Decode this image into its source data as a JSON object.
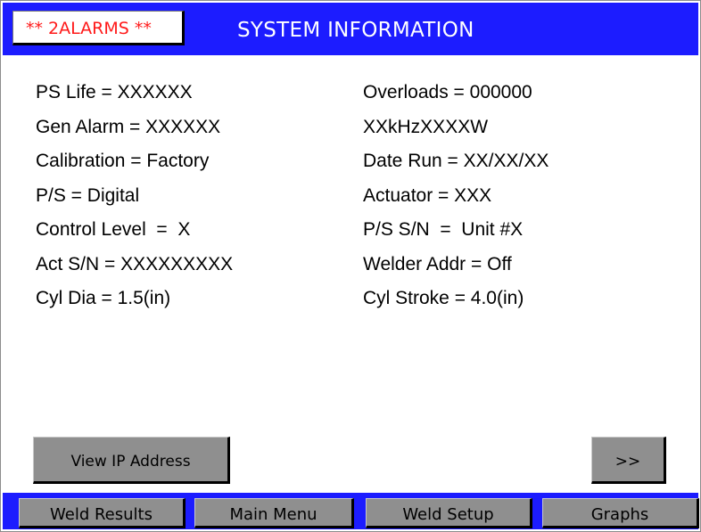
{
  "header": {
    "alarm_label": "** 2ALARMS **",
    "title": "SYSTEM INFORMATION"
  },
  "info": {
    "left": [
      "PS Life = XXXXXX",
      "Gen Alarm = XXXXXX",
      "Calibration = Factory",
      "P/S = Digital",
      "Control Level  =  X",
      "Act S/N = XXXXXXXXX",
      "Cyl Dia = 1.5(in)"
    ],
    "right": [
      "Overloads = 000000",
      "XXkHzXXXXW",
      "Date Run = XX/XX/XX",
      "Actuator = XXX",
      "P/S S/N  =  Unit #X",
      "Welder Addr = Off",
      "Cyl Stroke = 4.0(in)"
    ]
  },
  "buttons": {
    "view_ip": "View IP Address",
    "next": ">>"
  },
  "footer": {
    "nav": [
      "Weld Results",
      "Main Menu",
      "Weld Setup",
      "Graphs"
    ]
  },
  "colors": {
    "header_blue": "#1c1cff",
    "alarm_red": "#ff1a1a",
    "button_gray": "#8f8f8f"
  }
}
